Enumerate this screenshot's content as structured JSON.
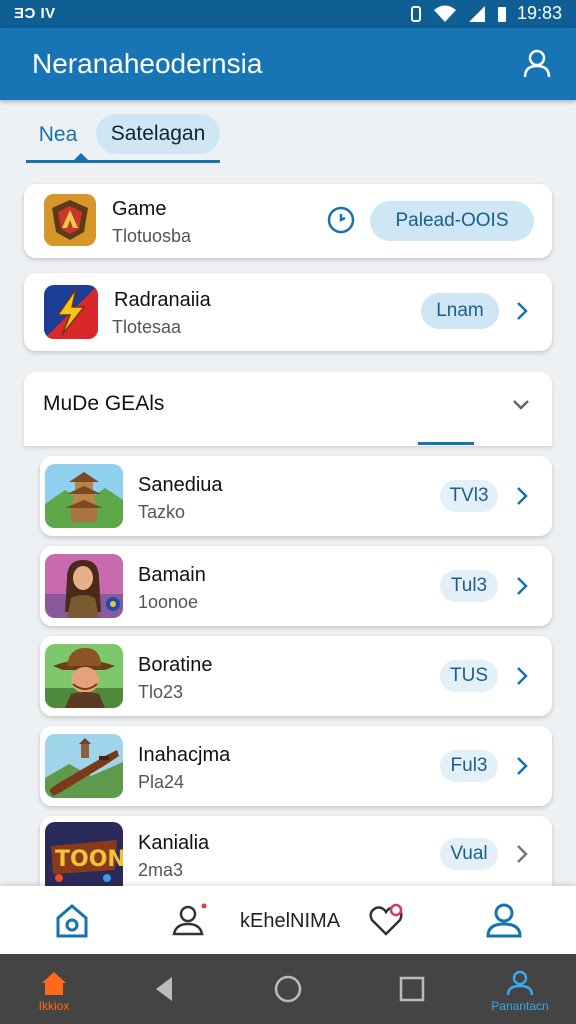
{
  "status": {
    "left_text": "ƎƆ IV",
    "time": "19:83"
  },
  "app": {
    "title": "Neranaheodernsia"
  },
  "tabs": [
    {
      "label": "Nea",
      "active": true
    },
    {
      "label": "Satelagan",
      "active": false
    }
  ],
  "featured": [
    {
      "title": "Game",
      "subtitle": "Tlotuosba",
      "action": "Palead-OOIS",
      "icon": "game-shield-icon"
    },
    {
      "title": "Radranaiia",
      "subtitle": "Tlotesaa",
      "action": "Lnam",
      "icon": "lightning-icon"
    }
  ],
  "section": {
    "title": "MuDe GEAls"
  },
  "list": [
    {
      "title": "Sanediua",
      "subtitle": "Tazko",
      "action": "TVl3",
      "icon": "pagoda-thumbnail"
    },
    {
      "title": "Bamain",
      "subtitle": "1oonoe",
      "action": "Tul3",
      "icon": "woman-thumbnail"
    },
    {
      "title": "Boratine",
      "subtitle": "Tlo23",
      "action": "TUS",
      "icon": "cowboy-thumbnail"
    },
    {
      "title": "Inahacjma",
      "subtitle": "Pla24",
      "action": "Ful3",
      "icon": "rifle-thumbnail"
    },
    {
      "title": "Kanialia",
      "subtitle": "2ma3",
      "action": "Vual",
      "icon": "toon-thumbnail"
    }
  ],
  "bottom_nav": {
    "center_label": "kEhelNIMA"
  },
  "sys_nav": {
    "home_label": "Ikkiox",
    "profile_label": "Panantacn"
  },
  "colors": {
    "primary": "#1875b5",
    "pill_bg": "#cfe6f4",
    "accent": "#1573ad",
    "home": "#ff6a1a"
  }
}
